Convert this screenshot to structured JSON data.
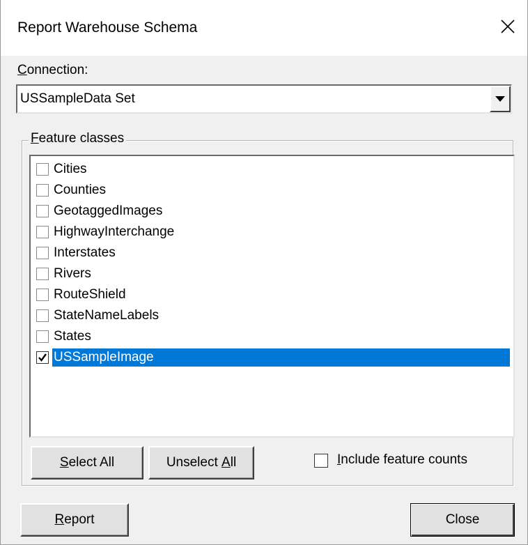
{
  "window": {
    "title": "Report Warehouse Schema"
  },
  "connection": {
    "label_accel": "C",
    "label_rest": "onnection:",
    "value": "USSampleData Set"
  },
  "feature_classes": {
    "legend_accel": "F",
    "legend_rest": "eature classes",
    "items": [
      {
        "label": "Cities",
        "checked": false
      },
      {
        "label": "Counties",
        "checked": false
      },
      {
        "label": "GeotaggedImages",
        "checked": false
      },
      {
        "label": "HighwayInterchange",
        "checked": false
      },
      {
        "label": "Interstates",
        "checked": false
      },
      {
        "label": "Rivers",
        "checked": false
      },
      {
        "label": "RouteShield",
        "checked": false
      },
      {
        "label": "StateNameLabels",
        "checked": false
      },
      {
        "label": "States",
        "checked": false
      },
      {
        "label": "USSampleImage",
        "checked": true,
        "selected": true
      }
    ],
    "select_all": {
      "accel": "S",
      "rest": "elect All"
    },
    "unselect_all": {
      "pre": "Unselect ",
      "accel": "A",
      "rest": "ll"
    },
    "include_counts": {
      "accel": "I",
      "rest": "nclude feature counts",
      "checked": false
    }
  },
  "footer": {
    "report": {
      "accel": "R",
      "rest": "eport"
    },
    "close_label": "Close"
  },
  "colors": {
    "selection": "#0078d7",
    "dialog_bg": "#f0f0f0"
  }
}
